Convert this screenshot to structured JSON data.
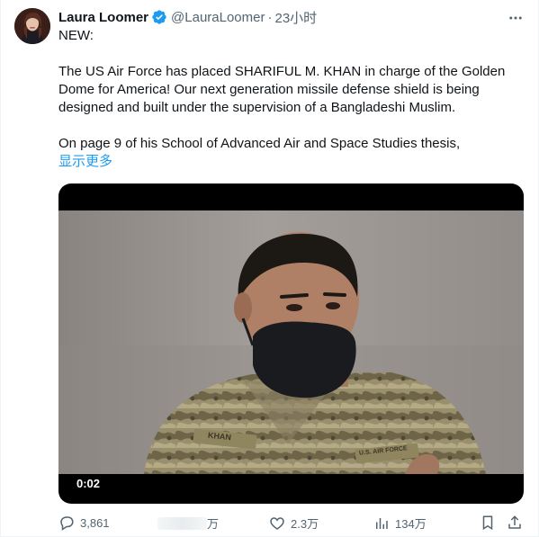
{
  "tweet": {
    "author": {
      "name": "Laura Loomer",
      "handle": "@LauraLoomer",
      "verified": true,
      "avatar_icon": "profile-photo"
    },
    "timestamp": "23小时",
    "text": {
      "line1": "NEW:",
      "paragraph2": "The US Air Force has placed SHARIFUL M. KHAN in charge of the Golden Dome for America! Our next generation missile defense shield is being designed and built under the supervision of a Bangladeshi Muslim.",
      "paragraph3": "On page 9 of his School of Advanced Air and Space Studies thesis,",
      "show_more": "显示更多"
    },
    "media": {
      "type": "video",
      "elapsed": "0:02",
      "name_tape": "KHAN",
      "branch_tape": "U.S. AIR FORCE"
    },
    "actions": {
      "replies": "3,861",
      "reposts": "万",
      "likes": "2.3万",
      "views": "134万"
    }
  },
  "colors": {
    "accent": "#1d9bf0",
    "secondary_text": "#536471",
    "primary_text": "#0f1419"
  }
}
